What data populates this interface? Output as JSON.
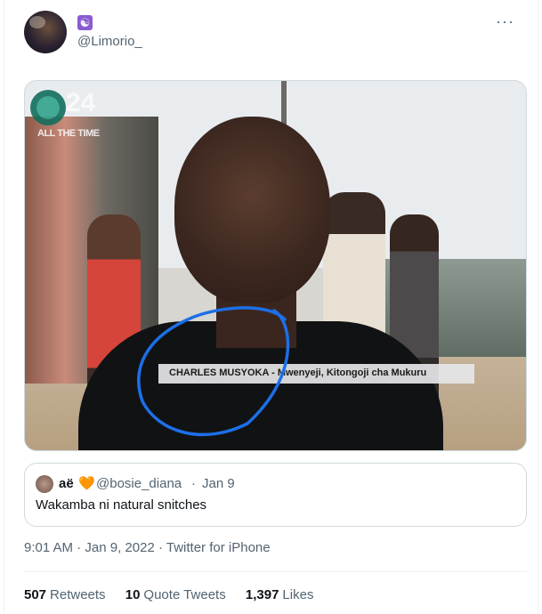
{
  "author": {
    "display_emoji": "☯",
    "handle": "@Limorio_"
  },
  "more_glyph": "···",
  "media": {
    "channel_number": "24",
    "channel_tagline": "ALL THE TIME",
    "lower_third": "CHARLES MUSYOKA - Mwenyeji, Kitongoji cha Mukuru",
    "annotation_color": "#1d6fe8"
  },
  "quoted": {
    "name": "aë",
    "heart": "🧡",
    "handle": "@bosie_diana",
    "separator": "·",
    "date": "Jan 9",
    "text": "Wakamba ni natural snitches"
  },
  "meta": {
    "time": "9:01 AM",
    "separator": "·",
    "date": "Jan 9, 2022",
    "source": "Twitter for iPhone"
  },
  "stats": {
    "retweets_count": "507",
    "retweets_label": "Retweets",
    "quotes_count": "10",
    "quotes_label": "Quote Tweets",
    "likes_count": "1,397",
    "likes_label": "Likes"
  },
  "colors": {
    "text_primary": "#0f1419",
    "text_secondary": "#536471",
    "border": "#cfd9de",
    "heart": "#ff8c1a"
  }
}
